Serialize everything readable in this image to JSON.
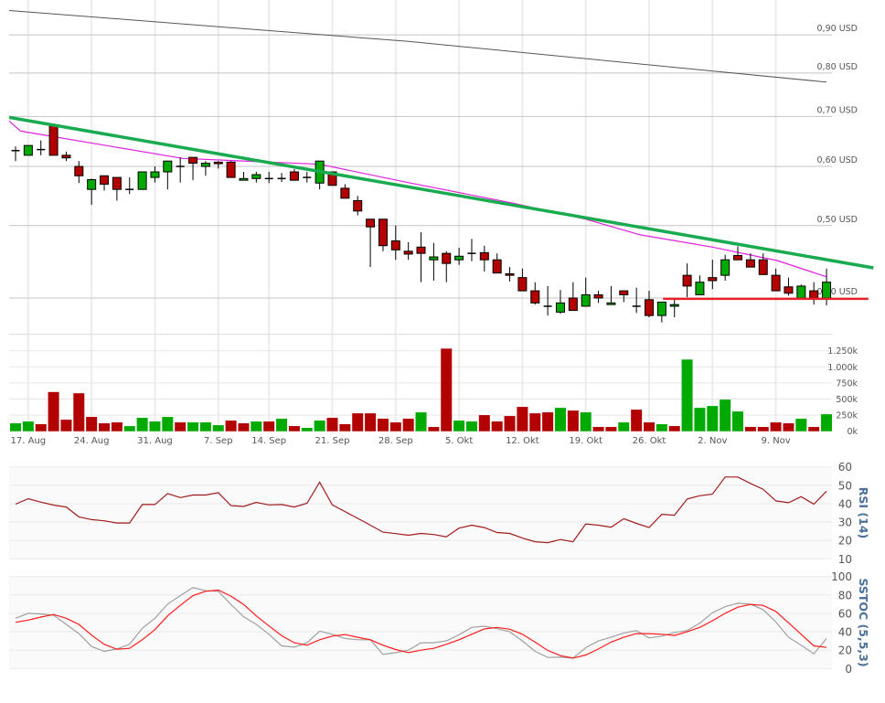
{
  "chart_data": [
    {
      "type": "candlestick",
      "panel": "price",
      "y_scale": "log",
      "ylim": [
        0.358,
        1.0
      ],
      "y_ticks": [
        {
          "value": 0.9,
          "label": "0,90 USD"
        },
        {
          "value": 0.8,
          "label": "0,80 USD"
        },
        {
          "value": 0.7,
          "label": "0,70 USD"
        },
        {
          "value": 0.6,
          "label": "0,60 USD"
        },
        {
          "value": 0.5,
          "label": "0,50 USD"
        },
        {
          "value": 0.4,
          "label": "0,40 USD"
        }
      ],
      "x_ticks": [
        {
          "index": 1,
          "label": "17. Aug"
        },
        {
          "index": 6,
          "label": "24. Aug"
        },
        {
          "index": 11,
          "label": "31. Aug"
        },
        {
          "index": 16,
          "label": "7. Sep"
        },
        {
          "index": 20,
          "label": "14. Sep"
        },
        {
          "index": 25,
          "label": "21. Sep"
        },
        {
          "index": 30,
          "label": "28. Sep"
        },
        {
          "index": 35,
          "label": "5. Okt"
        },
        {
          "index": 40,
          "label": "12. Okt"
        },
        {
          "index": 45,
          "label": "19. Okt"
        },
        {
          "index": 50,
          "label": "26. Okt"
        },
        {
          "index": 55,
          "label": "2. Nov"
        },
        {
          "index": 60,
          "label": "9. Nov"
        }
      ],
      "ohlc_columns": [
        "open",
        "high",
        "low",
        "close"
      ],
      "ohlc": [
        [
          0.63,
          0.638,
          0.61,
          0.63
        ],
        [
          0.621,
          0.64,
          0.621,
          0.64
        ],
        [
          0.632,
          0.65,
          0.621,
          0.63
        ],
        [
          0.68,
          0.68,
          0.621,
          0.621
        ],
        [
          0.621,
          0.628,
          0.61,
          0.616
        ],
        [
          0.6,
          0.61,
          0.57,
          0.583
        ],
        [
          0.559,
          0.578,
          0.533,
          0.576
        ],
        [
          0.583,
          0.583,
          0.557,
          0.568
        ],
        [
          0.58,
          0.58,
          0.54,
          0.559
        ],
        [
          0.559,
          0.58,
          0.551,
          0.558
        ],
        [
          0.559,
          0.59,
          0.559,
          0.59
        ],
        [
          0.58,
          0.6,
          0.571,
          0.59
        ],
        [
          0.59,
          0.61,
          0.559,
          0.61
        ],
        [
          0.6,
          0.617,
          0.571,
          0.6
        ],
        [
          0.617,
          0.617,
          0.575,
          0.606
        ],
        [
          0.6,
          0.61,
          0.583,
          0.606
        ],
        [
          0.608,
          0.61,
          0.596,
          0.605
        ],
        [
          0.608,
          0.61,
          0.58,
          0.58
        ],
        [
          0.575,
          0.59,
          0.575,
          0.578
        ],
        [
          0.578,
          0.59,
          0.571,
          0.585
        ],
        [
          0.578,
          0.59,
          0.57,
          0.578
        ],
        [
          0.578,
          0.588,
          0.572,
          0.578
        ],
        [
          0.59,
          0.595,
          0.575,
          0.575
        ],
        [
          0.58,
          0.59,
          0.571,
          0.58
        ],
        [
          0.57,
          0.61,
          0.559,
          0.61
        ],
        [
          0.59,
          0.59,
          0.566,
          0.566
        ],
        [
          0.561,
          0.568,
          0.544,
          0.544
        ],
        [
          0.54,
          0.548,
          0.516,
          0.523
        ],
        [
          0.51,
          0.51,
          0.44,
          0.498
        ],
        [
          0.51,
          0.51,
          0.462,
          0.47
        ],
        [
          0.477,
          0.5,
          0.45,
          0.464
        ],
        [
          0.462,
          0.475,
          0.45,
          0.458
        ],
        [
          0.468,
          0.49,
          0.42,
          0.459
        ],
        [
          0.45,
          0.474,
          0.422,
          0.454
        ],
        [
          0.459,
          0.462,
          0.42,
          0.445
        ],
        [
          0.45,
          0.467,
          0.443,
          0.455
        ],
        [
          0.459,
          0.48,
          0.448,
          0.459
        ],
        [
          0.46,
          0.47,
          0.434,
          0.45
        ],
        [
          0.45,
          0.459,
          0.432,
          0.432
        ],
        [
          0.431,
          0.44,
          0.421,
          0.429
        ],
        [
          0.426,
          0.438,
          0.409,
          0.409
        ],
        [
          0.409,
          0.42,
          0.392,
          0.394
        ],
        [
          0.39,
          0.415,
          0.379,
          0.39
        ],
        [
          0.383,
          0.41,
          0.381,
          0.394
        ],
        [
          0.4,
          0.42,
          0.385,
          0.385
        ],
        [
          0.39,
          0.426,
          0.39,
          0.404
        ],
        [
          0.404,
          0.409,
          0.394,
          0.4
        ],
        [
          0.392,
          0.415,
          0.392,
          0.394
        ],
        [
          0.409,
          0.409,
          0.395,
          0.404
        ],
        [
          0.39,
          0.413,
          0.382,
          0.39
        ],
        [
          0.398,
          0.409,
          0.377,
          0.379
        ],
        [
          0.379,
          0.395,
          0.371,
          0.395
        ],
        [
          0.39,
          0.398,
          0.377,
          0.392
        ],
        [
          0.429,
          0.445,
          0.401,
          0.415
        ],
        [
          0.404,
          0.429,
          0.404,
          0.42
        ],
        [
          0.426,
          0.45,
          0.411,
          0.422
        ],
        [
          0.429,
          0.457,
          0.422,
          0.45
        ],
        [
          0.456,
          0.469,
          0.45,
          0.45
        ],
        [
          0.45,
          0.459,
          0.44,
          0.44
        ],
        [
          0.45,
          0.459,
          0.43,
          0.43
        ],
        [
          0.429,
          0.438,
          0.409,
          0.409
        ],
        [
          0.414,
          0.426,
          0.403,
          0.406
        ],
        [
          0.4,
          0.417,
          0.4,
          0.415
        ],
        [
          0.409,
          0.42,
          0.392,
          0.4
        ],
        [
          0.4,
          0.438,
          0.391,
          0.42
        ]
      ],
      "overlays": [
        {
          "kind": "moving-average",
          "color": "#555555",
          "points": [
            [
              -0.5,
              0.97
            ],
            [
              31,
              0.882
            ],
            [
              64,
              0.778
            ]
          ]
        },
        {
          "kind": "moving-average",
          "color": "#e020e0",
          "points": [
            [
              -0.5,
              0.69
            ],
            [
              0.4,
              0.669
            ],
            [
              13.2,
              0.615
            ],
            [
              24,
              0.604
            ],
            [
              31.2,
              0.57
            ],
            [
              39.2,
              0.536
            ],
            [
              45,
              0.51
            ],
            [
              49.3,
              0.486
            ],
            [
              55,
              0.468
            ],
            [
              60.1,
              0.449
            ],
            [
              64,
              0.427
            ]
          ]
        },
        {
          "kind": "trendline",
          "color": "#1aaa50",
          "points": [
            [
              -0.5,
              0.698
            ],
            [
              67.7,
              0.439
            ]
          ]
        },
        {
          "kind": "support-line",
          "color": "#e8202a",
          "points": [
            [
              51.1,
              0.399
            ],
            [
              67.3,
              0.399
            ]
          ]
        }
      ],
      "up_color": "#00aa00",
      "down_color": "#b30000"
    },
    {
      "type": "bar",
      "panel": "volume",
      "ylim": [
        0,
        1250000
      ],
      "y_ticks": [
        {
          "value": 1250000,
          "label": "1.250k"
        },
        {
          "value": 1000000,
          "label": "1.000k"
        },
        {
          "value": 750000,
          "label": "750k"
        },
        {
          "value": 500000,
          "label": "500k"
        },
        {
          "value": 250000,
          "label": "250k"
        },
        {
          "value": 0,
          "label": "0k"
        }
      ],
      "values": [
        123000,
        151000,
        109000,
        609000,
        179000,
        590000,
        222000,
        123000,
        137000,
        80000,
        208000,
        151000,
        222000,
        137000,
        137000,
        137000,
        94000,
        165000,
        123000,
        151000,
        151000,
        194000,
        80000,
        52000,
        165000,
        208000,
        109000,
        278000,
        278000,
        194000,
        137000,
        194000,
        293000,
        66000,
        1284000,
        165000,
        151000,
        250000,
        151000,
        236000,
        378000,
        278000,
        293000,
        363000,
        321000,
        293000,
        66000,
        66000,
        137000,
        335000,
        137000,
        109000,
        80000,
        1114000,
        363000,
        392000,
        491000,
        307000,
        66000,
        66000,
        137000,
        123000,
        194000,
        66000,
        264000
      ],
      "direction": [
        "up",
        "up",
        "down",
        "down",
        "down",
        "down",
        "down",
        "down",
        "down",
        "up",
        "up",
        "up",
        "up",
        "down",
        "up",
        "up",
        "up",
        "down",
        "down",
        "up",
        "down",
        "up",
        "down",
        "up",
        "up",
        "down",
        "down",
        "down",
        "down",
        "down",
        "down",
        "down",
        "up",
        "down",
        "down",
        "up",
        "up",
        "down",
        "down",
        "down",
        "down",
        "down",
        "down",
        "up",
        "down",
        "up",
        "down",
        "down",
        "up",
        "down",
        "down",
        "up",
        "down",
        "up",
        "up",
        "up",
        "up",
        "up",
        "down",
        "down",
        "down",
        "down",
        "up",
        "down",
        "up"
      ]
    },
    {
      "type": "line",
      "panel": "rsi",
      "title": "RSI (14)",
      "ylim": [
        10,
        60
      ],
      "y_ticks": [
        "60",
        "50",
        "40",
        "30",
        "20",
        "10"
      ],
      "series": [
        {
          "color": "#a01c1c",
          "values": [
            39.7,
            42.7,
            40.8,
            39.2,
            38.2,
            32.8,
            31.3,
            30.7,
            29.5,
            29.5,
            39.5,
            39.5,
            45.5,
            43.3,
            44.7,
            44.7,
            46.0,
            39.0,
            38.5,
            40.7,
            39.3,
            39.5,
            38.2,
            40.2,
            51.7,
            39.3,
            35.7,
            32.0,
            28.3,
            24.5,
            23.7,
            22.8,
            23.8,
            23.2,
            22.0,
            26.7,
            28.3,
            27.0,
            24.3,
            23.8,
            21.3,
            19.3,
            18.8,
            20.5,
            19.3,
            29.0,
            28.3,
            27.2,
            31.8,
            29.3,
            27.0,
            34.2,
            33.7,
            42.5,
            44.3,
            45.2,
            54.5,
            54.5,
            51.0,
            47.8,
            41.5,
            40.5,
            43.8,
            39.7,
            46.8
          ]
        }
      ]
    },
    {
      "type": "line",
      "panel": "sstoc",
      "title": "SSTOC (5,5,3)",
      "ylim": [
        0,
        100
      ],
      "y_ticks": [
        "100",
        "80",
        "60",
        "40",
        "20",
        "0"
      ],
      "series": [
        {
          "color": "#a0a0a0",
          "values": [
            54.7,
            60.0,
            59.3,
            58.0,
            48.0,
            38.0,
            24.0,
            18.7,
            21.3,
            26.3,
            43.7,
            54.7,
            70.0,
            79.3,
            88.0,
            84.7,
            84.0,
            69.7,
            56.3,
            48.0,
            37.3,
            24.7,
            23.3,
            28.0,
            40.7,
            37.3,
            32.7,
            31.3,
            31.3,
            15.3,
            17.3,
            20.0,
            28.0,
            28.0,
            30.0,
            36.7,
            44.7,
            46.0,
            43.3,
            40.0,
            30.0,
            18.7,
            12.0,
            12.3,
            11.3,
            22.7,
            30.0,
            34.0,
            38.7,
            41.3,
            33.3,
            35.3,
            39.3,
            41.3,
            49.3,
            60.7,
            67.3,
            71.0,
            70.0,
            64.0,
            50.7,
            34.0,
            25.3,
            16.0,
            32.7
          ]
        },
        {
          "color": "#ff1a1a",
          "values": [
            50.3,
            52.7,
            56.0,
            58.7,
            54.7,
            48.0,
            36.3,
            26.3,
            21.0,
            22.0,
            31.3,
            42.3,
            57.3,
            68.7,
            79.3,
            84.0,
            85.3,
            78.7,
            69.7,
            57.3,
            46.3,
            35.7,
            28.0,
            25.3,
            31.3,
            35.3,
            37.0,
            34.0,
            31.3,
            25.3,
            20.7,
            17.3,
            20.0,
            22.0,
            26.3,
            31.3,
            37.3,
            43.0,
            44.7,
            42.7,
            37.3,
            28.7,
            19.7,
            14.0,
            11.3,
            14.7,
            21.3,
            28.7,
            34.0,
            38.0,
            38.0,
            37.3,
            36.0,
            40.0,
            44.7,
            52.0,
            60.0,
            66.7,
            69.7,
            68.7,
            62.0,
            49.7,
            37.3,
            24.7,
            23.0
          ]
        }
      ]
    }
  ]
}
